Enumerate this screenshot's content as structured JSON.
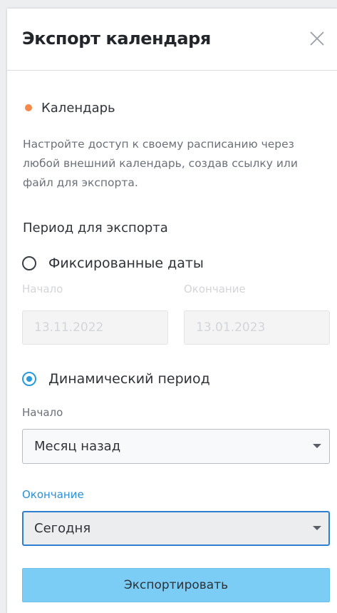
{
  "dialog": {
    "title": "Экспорт календаря",
    "close_icon": "close-icon"
  },
  "calendar": {
    "label": "Календарь",
    "dot_color": "#f5894a"
  },
  "description": "Настройте доступ к своему расписанию через любой внешний календарь, создав ссылку или файл для экспорта.",
  "period": {
    "section_label": "Период для экспорта",
    "fixed": {
      "label": "Фиксированные даты",
      "selected": false,
      "start_label": "Начало",
      "end_label": "Окончание",
      "start_value": "13.11.2022",
      "end_value": "13.01.2023"
    },
    "dynamic": {
      "label": "Динамический период",
      "selected": true,
      "start_label": "Начало",
      "start_value": "Месяц назад",
      "end_label": "Окончание",
      "end_value": "Сегодня"
    }
  },
  "export_button": {
    "label": "Экспортировать",
    "color": "#7ccdf5"
  },
  "accent_color": "#2a9bdc"
}
